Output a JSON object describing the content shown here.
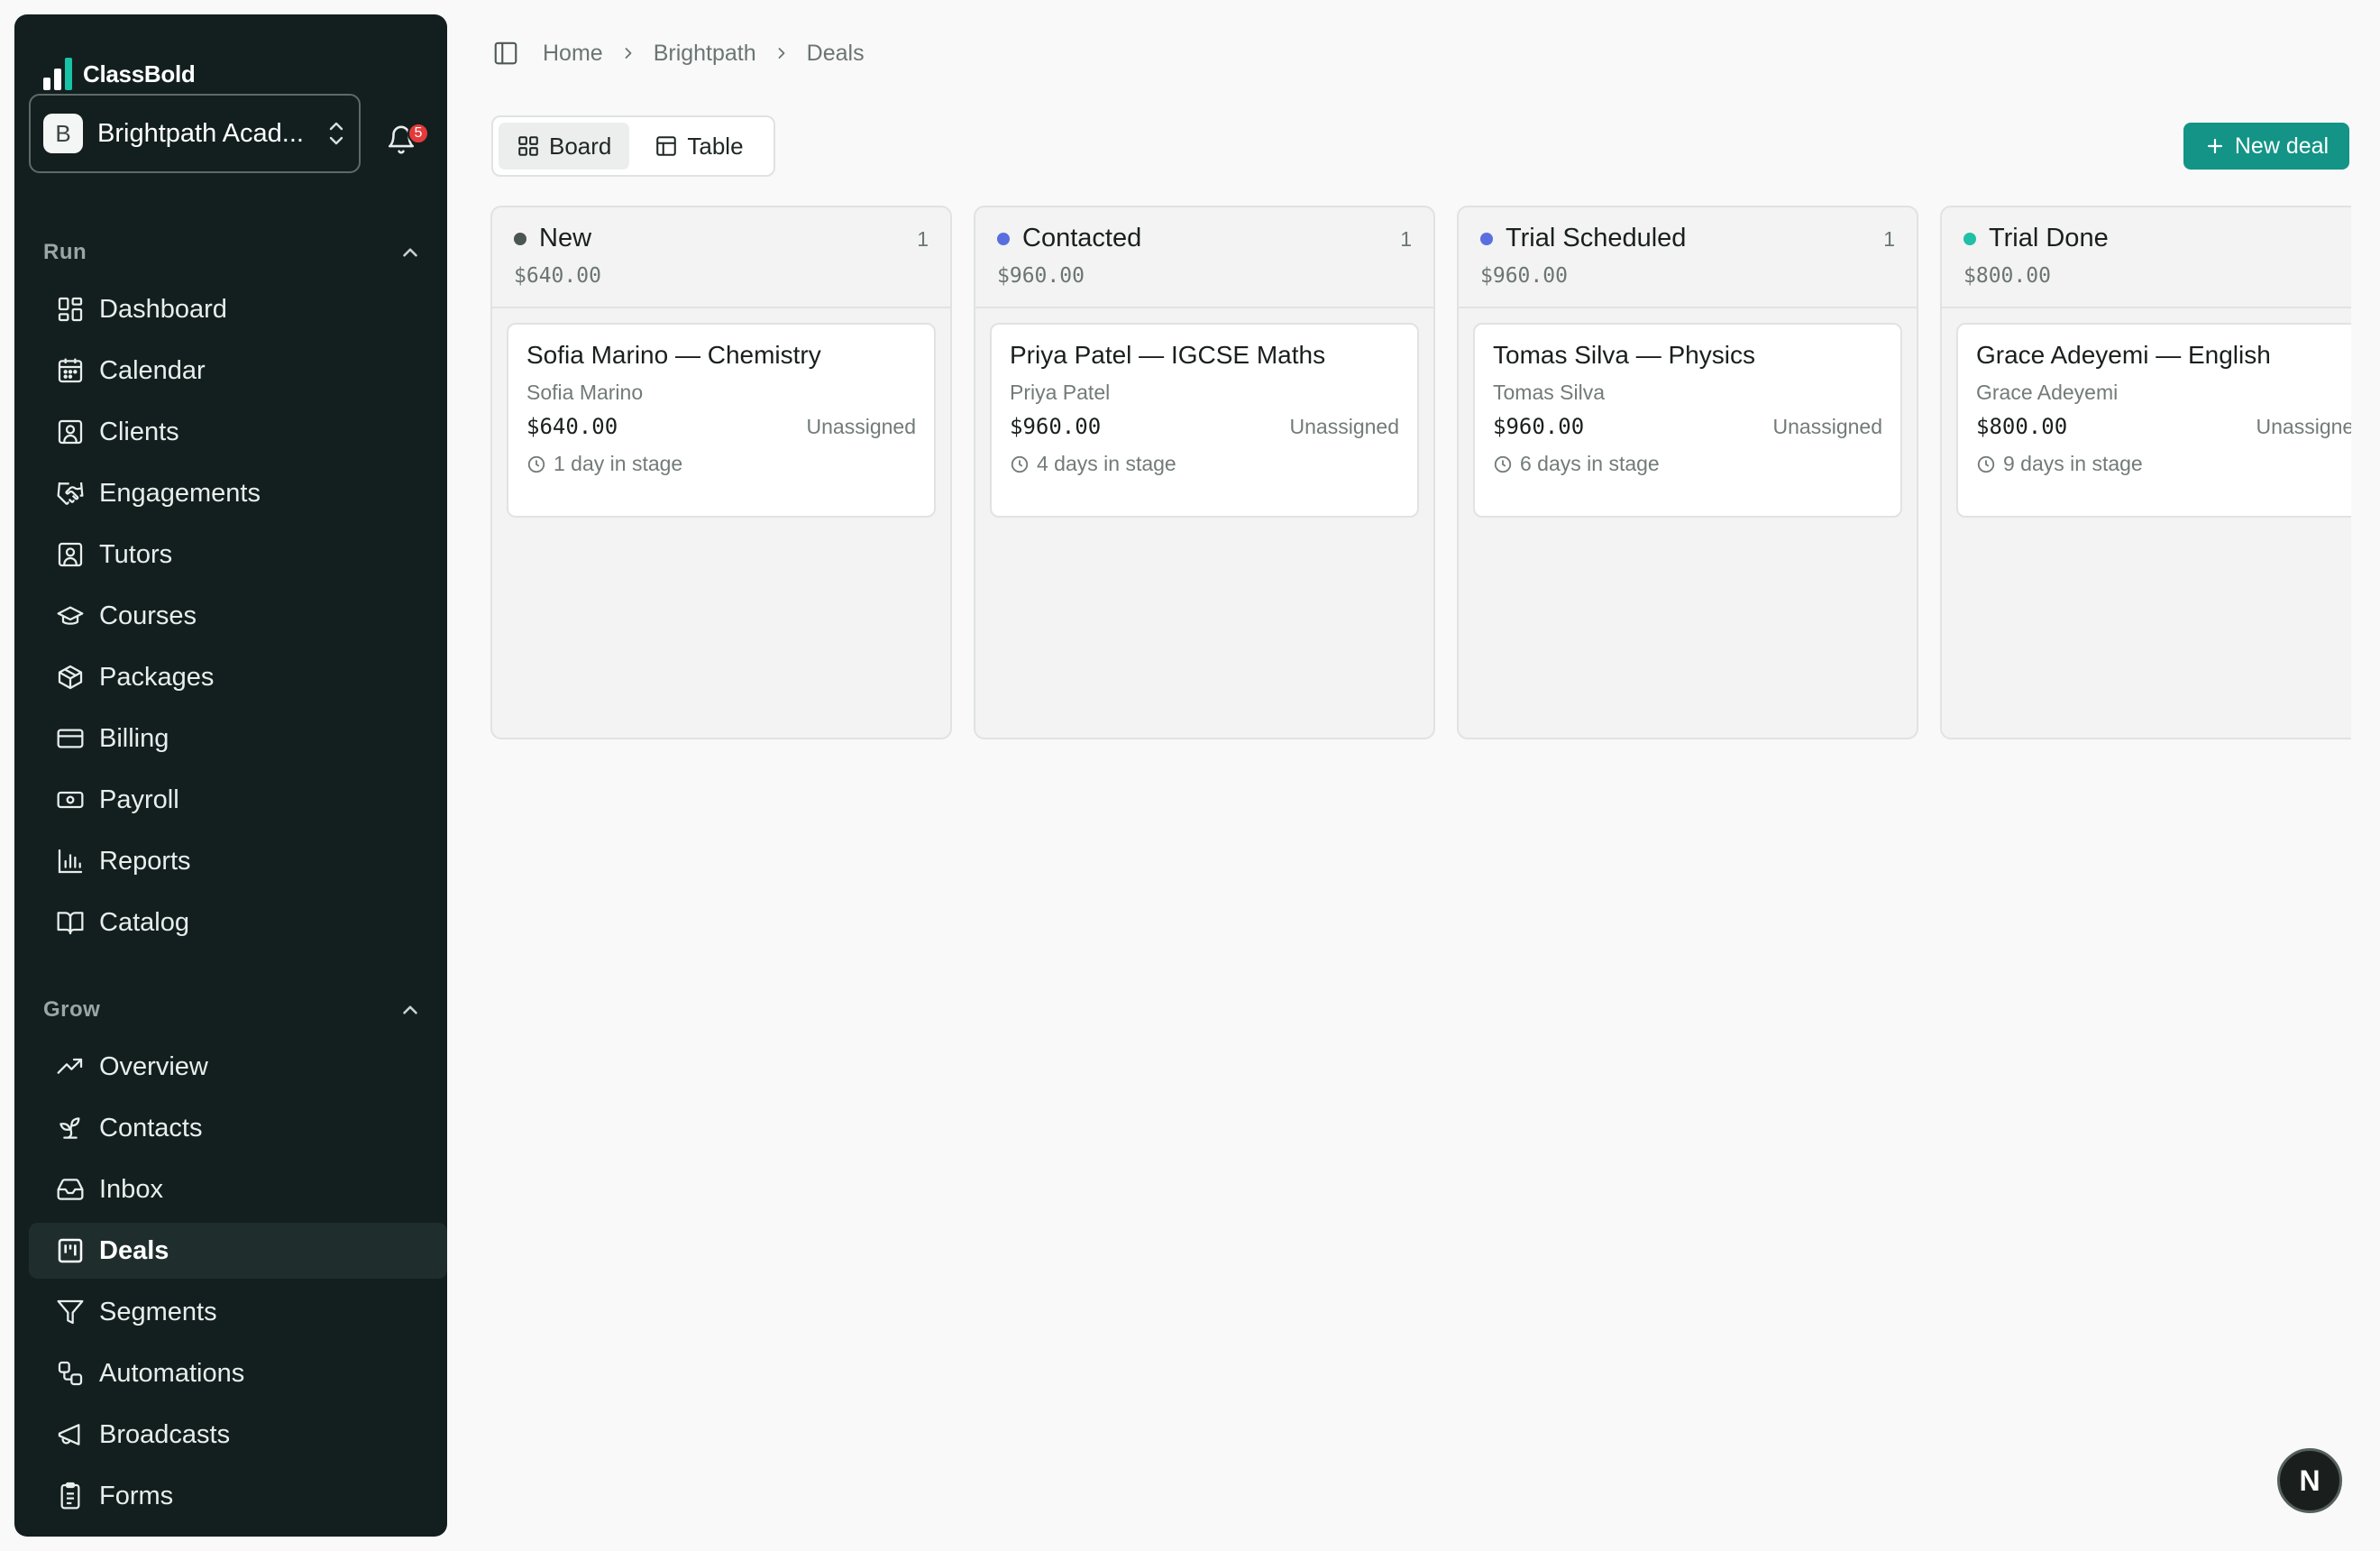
{
  "app": {
    "name": "ClassBold"
  },
  "org": {
    "name": "Brightpath Acad...",
    "initial": "B"
  },
  "notifications": {
    "count": "5"
  },
  "sections": [
    {
      "label": "Run"
    },
    {
      "label": "Grow"
    }
  ],
  "nav_run": [
    {
      "label": "Dashboard",
      "icon": "dashboard-icon"
    },
    {
      "label": "Calendar",
      "icon": "calendar-icon"
    },
    {
      "label": "Clients",
      "icon": "clients-icon"
    },
    {
      "label": "Engagements",
      "icon": "engagements-icon"
    },
    {
      "label": "Tutors",
      "icon": "tutors-icon"
    },
    {
      "label": "Courses",
      "icon": "courses-icon"
    },
    {
      "label": "Packages",
      "icon": "packages-icon"
    },
    {
      "label": "Billing",
      "icon": "billing-icon"
    },
    {
      "label": "Payroll",
      "icon": "payroll-icon"
    },
    {
      "label": "Reports",
      "icon": "reports-icon"
    },
    {
      "label": "Catalog",
      "icon": "catalog-icon"
    }
  ],
  "nav_grow": [
    {
      "label": "Overview",
      "icon": "overview-icon"
    },
    {
      "label": "Contacts",
      "icon": "contacts-icon"
    },
    {
      "label": "Inbox",
      "icon": "inbox-icon"
    },
    {
      "label": "Deals",
      "icon": "deals-icon",
      "active": true
    },
    {
      "label": "Segments",
      "icon": "segments-icon"
    },
    {
      "label": "Automations",
      "icon": "automations-icon"
    },
    {
      "label": "Broadcasts",
      "icon": "broadcasts-icon"
    },
    {
      "label": "Forms",
      "icon": "forms-icon"
    }
  ],
  "breadcrumb": [
    "Home",
    "Brightpath",
    "Deals"
  ],
  "view_toggle": {
    "board": "Board",
    "table": "Table",
    "active": "Board"
  },
  "new_deal_label": "New deal",
  "columns": [
    {
      "name": "New",
      "count": "1",
      "total": "$640.00",
      "color": "#4b5553",
      "card": {
        "title": "Sofia Marino — Chemistry",
        "contact": "Sofia Marino",
        "amount": "$640.00",
        "owner": "Unassigned",
        "days": "1 day in stage"
      }
    },
    {
      "name": "Contacted",
      "count": "1",
      "total": "$960.00",
      "color": "#5b6ee0",
      "card": {
        "title": "Priya Patel — IGCSE Maths",
        "contact": "Priya Patel",
        "amount": "$960.00",
        "owner": "Unassigned",
        "days": "4 days in stage"
      }
    },
    {
      "name": "Trial Scheduled",
      "count": "1",
      "total": "$960.00",
      "color": "#5b6ee0",
      "card": {
        "title": "Tomas Silva — Physics",
        "contact": "Tomas Silva",
        "amount": "$960.00",
        "owner": "Unassigned",
        "days": "6 days in stage"
      }
    },
    {
      "name": "Trial Done",
      "count": "",
      "total": "$800.00",
      "color": "#21bfa6",
      "card": {
        "title": "Grace Adeyemi — English",
        "contact": "Grace Adeyemi",
        "amount": "$800.00",
        "owner": "Unassigned",
        "days": "9 days in stage"
      }
    }
  ],
  "fab_label": "N"
}
